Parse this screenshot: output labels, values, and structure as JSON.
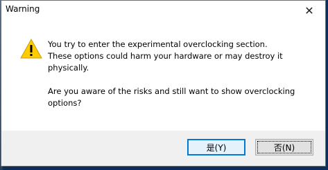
{
  "dialog": {
    "title": "Warning",
    "close_glyph": "✕",
    "icon": "warning-icon",
    "paragraph1_line1": "You try to enter the experimental overclocking section.",
    "paragraph1_line2": "These options could harm your hardware or may destroy it",
    "paragraph1_line3": "physically.",
    "paragraph2_line1": "Are you aware of the risks and still want to show overclocking",
    "paragraph2_line2": "options?"
  },
  "buttons": {
    "yes_label": "是(Y)",
    "no_label": "否(N)"
  },
  "colors": {
    "warning_fill": "#ffcc00",
    "default_button_border": "#0078d7"
  }
}
